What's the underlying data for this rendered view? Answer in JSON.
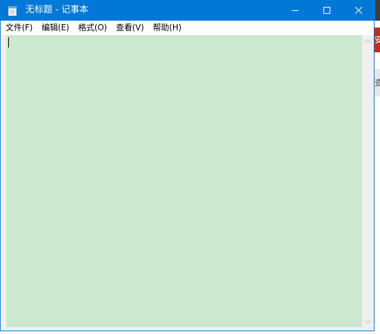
{
  "window": {
    "title": "无标题 - 记事本",
    "app_icon": "notepad-icon",
    "controls": {
      "minimize_icon": "minimize-icon",
      "maximize_icon": "maximize-icon",
      "close_icon": "close-icon"
    },
    "accent_color": "#0078d7"
  },
  "menu": {
    "items": [
      {
        "label": "文件(F)"
      },
      {
        "label": "编辑(E)"
      },
      {
        "label": "格式(O)"
      },
      {
        "label": "查看(V)"
      },
      {
        "label": "帮助(H)"
      }
    ]
  },
  "editor": {
    "content": "",
    "background_color": "#cce8cf"
  },
  "background": {
    "red_tab_text": "安",
    "gray_band_text": "查"
  }
}
